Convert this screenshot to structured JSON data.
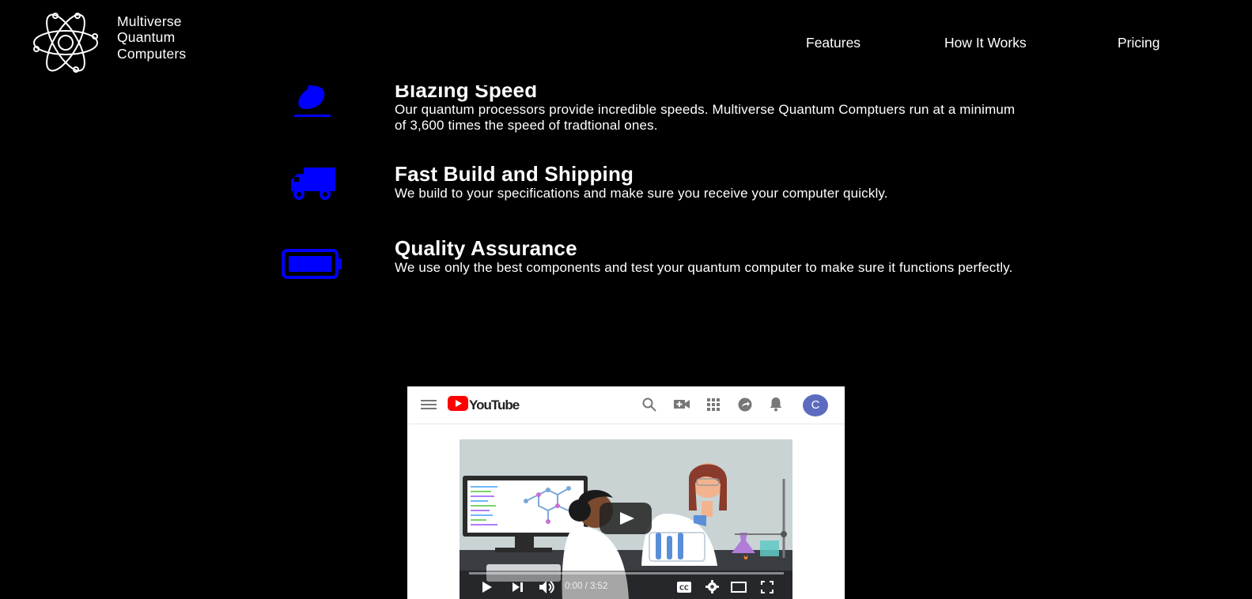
{
  "brand": {
    "lines": [
      "Multiverse",
      "Quantum",
      "Computers"
    ]
  },
  "nav": {
    "items": [
      "Features",
      "How It Works",
      "Pricing"
    ]
  },
  "features": [
    {
      "title": "Blazing Speed",
      "description": "Our quantum processors provide incredible speeds. Multiverse Quantum Comptuers run at a minimum of 3,600 times the speed of tradtional ones.",
      "icon": "fire-icon"
    },
    {
      "title": "Fast Build and Shipping",
      "description": "We build to your specifications and make sure you receive your computer quickly.",
      "icon": "truck-icon"
    },
    {
      "title": "Quality Assurance",
      "description": "We use only the best components and test your quantum computer to make sure it functions perfectly.",
      "icon": "battery-icon"
    }
  ],
  "video": {
    "site_logo": "YouTube",
    "avatar_letter": "C",
    "time": "0:00 / 3:52",
    "progress": 0
  },
  "colors": {
    "background": "#000000",
    "text": "#ffffff",
    "icon_accent": "#0000ff",
    "youtube_red": "#ff0000",
    "avatar": "#5c6bc0"
  }
}
